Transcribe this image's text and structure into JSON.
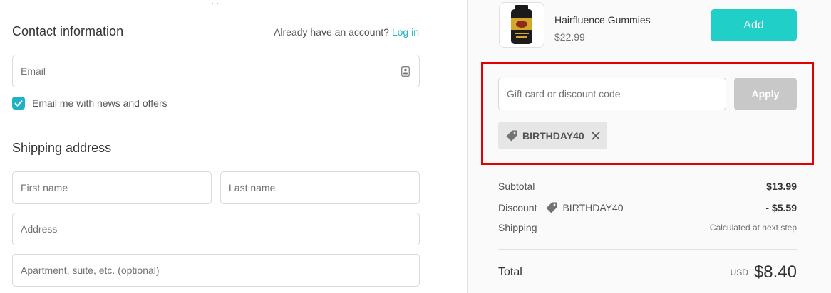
{
  "contact": {
    "title": "Contact information",
    "account_prompt": "Already have an account?",
    "login_link": "Log in",
    "email_placeholder": "Email",
    "newsletter_label": "Email me with news and offers",
    "newsletter_checked": true
  },
  "shipping": {
    "title": "Shipping address",
    "first_name_placeholder": "First name",
    "last_name_placeholder": "Last name",
    "address_placeholder": "Address",
    "apartment_placeholder": "Apartment, suite, etc. (optional)"
  },
  "upsell": {
    "product_name": "Hairfluence Gummies",
    "product_price": "$22.99",
    "add_label": "Add"
  },
  "discount": {
    "placeholder": "Gift card or discount code",
    "apply_label": "Apply",
    "applied_code": "BIRTHDAY40"
  },
  "summary": {
    "subtotal_label": "Subtotal",
    "subtotal_value": "$13.99",
    "discount_label": "Discount",
    "discount_code": "BIRTHDAY40",
    "discount_value": "- $5.59",
    "shipping_label": "Shipping",
    "shipping_value": "Calculated at next step",
    "total_label": "Total",
    "currency": "USD",
    "total_value": "$8.40"
  },
  "colors": {
    "accent": "#1fb3c2",
    "add_button": "#1fcfc8",
    "highlight": "#e40000",
    "apply_disabled": "#c8c8c8"
  },
  "icons": [
    "contact-card-icon",
    "checkmark-icon",
    "discount-tag-icon",
    "close-icon"
  ]
}
